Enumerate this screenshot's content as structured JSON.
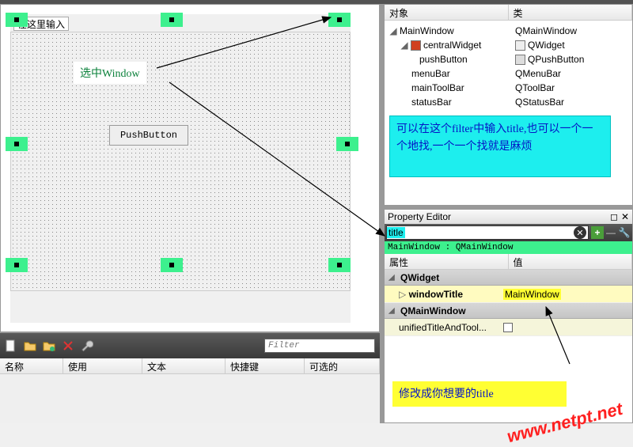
{
  "designer": {
    "title_placeholder": "在这里输入",
    "push_button_label": "PushButton",
    "annotation_select": "选中Window"
  },
  "action_panel": {
    "filter_placeholder": "Filter",
    "columns": {
      "name": "名称",
      "used": "使用",
      "text": "文本",
      "shortcut": "快捷键",
      "checkable": "可选的"
    }
  },
  "object_inspector": {
    "headers": {
      "object": "对象",
      "class": "类"
    },
    "tree": [
      {
        "indent": 0,
        "toggle": "◢",
        "name": "MainWindow",
        "class": "QMainWindow"
      },
      {
        "indent": 1,
        "toggle": "◢",
        "name": "centralWidget",
        "class": "QWidget"
      },
      {
        "indent": 2,
        "toggle": "",
        "name": "pushButton",
        "class": "QPushButton"
      },
      {
        "indent": 1,
        "toggle": "",
        "name": "menuBar",
        "class": "QMenuBar"
      },
      {
        "indent": 1,
        "toggle": "",
        "name": "mainToolBar",
        "class": "QToolBar"
      },
      {
        "indent": 1,
        "toggle": "",
        "name": "statusBar",
        "class": "QStatusBar"
      }
    ],
    "note": "可以在这个filter中输入title,也可以一个一个地找,一个一个找就是麻烦"
  },
  "property_editor": {
    "title": "Property Editor",
    "search_value": "title",
    "object_label": "MainWindow : QMainWindow",
    "headers": {
      "property": "属性",
      "value": "值"
    },
    "group1": "QWidget",
    "windowTitle_label": "windowTitle",
    "windowTitle_value": "MainWindow",
    "group2": "QMainWindow",
    "unified_label": "unifiedTitleAndTool...",
    "note": "修改成你想要的title"
  },
  "watermark": "www.netpt.net",
  "icons": {
    "file": "file-icon",
    "folder": "folder-icon",
    "edit": "edit-icon",
    "wrench": "wrench-icon",
    "red": "#d04020",
    "widget": "widget-icon",
    "btn": "button-icon"
  }
}
